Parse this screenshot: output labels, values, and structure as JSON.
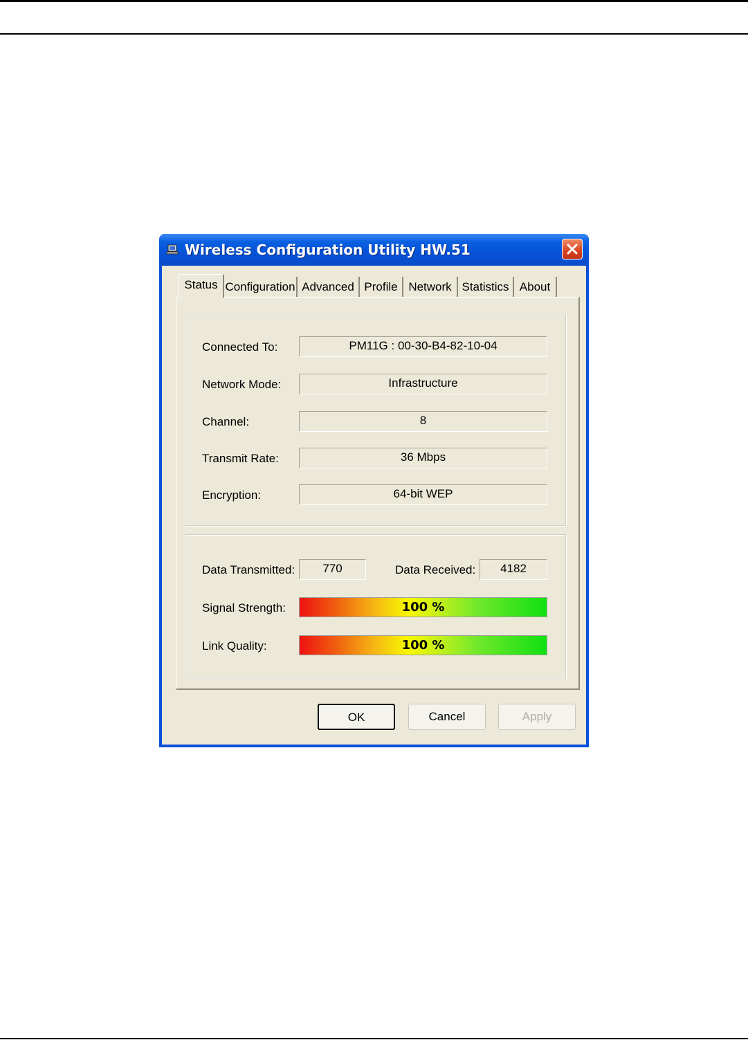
{
  "window": {
    "title": "Wireless Configuration Utility HW.51",
    "icons": {
      "app": "laptop-network-icon",
      "close": "close-icon"
    }
  },
  "tabs": [
    {
      "label": "Status",
      "active": true
    },
    {
      "label": "Configuration",
      "active": false
    },
    {
      "label": "Advanced",
      "active": false
    },
    {
      "label": "Profile",
      "active": false
    },
    {
      "label": "Network",
      "active": false
    },
    {
      "label": "Statistics",
      "active": false
    },
    {
      "label": "About",
      "active": false
    }
  ],
  "status": {
    "connected_to": {
      "label": "Connected To:",
      "value": "PM11G : 00-30-B4-82-10-04"
    },
    "network_mode": {
      "label": "Network Mode:",
      "value": "Infrastructure"
    },
    "channel": {
      "label": "Channel:",
      "value": "8"
    },
    "transmit_rate": {
      "label": "Transmit Rate:",
      "value": "36 Mbps"
    },
    "encryption": {
      "label": "Encryption:",
      "value": "64-bit WEP"
    }
  },
  "traffic": {
    "data_transmitted": {
      "label": "Data Transmitted:",
      "value": "770"
    },
    "data_received": {
      "label": "Data Received:",
      "value": "4182"
    },
    "signal_strength": {
      "label": "Signal Strength:",
      "text": "100 %",
      "percent": 100
    },
    "link_quality": {
      "label": "Link Quality:",
      "text": "100 %",
      "percent": 100
    }
  },
  "buttons": {
    "ok": "OK",
    "cancel": "Cancel",
    "apply": "Apply"
  },
  "colors": {
    "titlebar": "#0552d8",
    "window_face": "#ece9d8",
    "close_button": "#d9431e"
  }
}
